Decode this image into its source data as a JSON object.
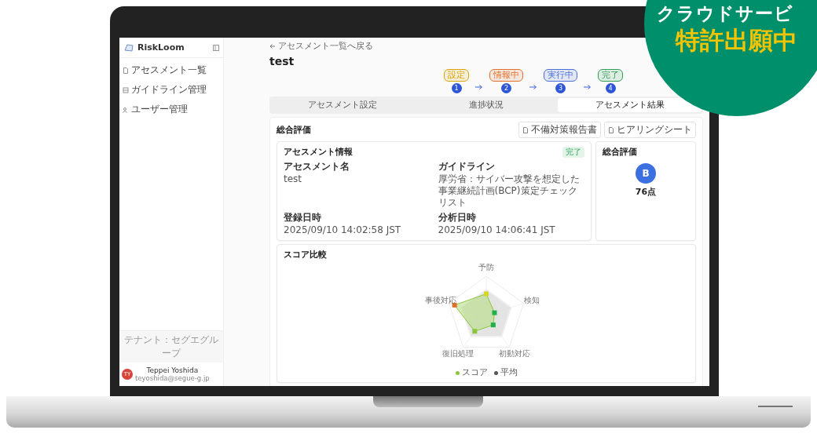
{
  "banner": {
    "line_1": "クラウドサービ",
    "line_2": "特許出願中"
  },
  "sidebar": {
    "brand": "RiskLoom",
    "items": [
      {
        "label": "アセスメント一覧",
        "selected": false
      },
      {
        "label": "ガイドライン管理",
        "selected": false
      },
      {
        "label": "ユーザー管理",
        "selected": false
      }
    ],
    "tenant": "テナント：セグエグループ",
    "user": {
      "initials": "TY",
      "name": "Teppei Yoshida",
      "email": "teyoshida@segue-g.jp"
    }
  },
  "main": {
    "back_link": "アセスメント一覧へ戻る",
    "title": "test",
    "steps": [
      {
        "label": "設定",
        "number": "1",
        "color": "#d9a400"
      },
      {
        "label": "情報中",
        "number": "2",
        "color": "#e0702a"
      },
      {
        "label": "実行中",
        "number": "3",
        "color": "#4a6fd8"
      },
      {
        "label": "完了",
        "number": "4",
        "color": "#2f9e57"
      }
    ],
    "tabs": [
      {
        "label": "アセスメント設定",
        "selected": false
      },
      {
        "label": "進捗状況",
        "selected": false
      },
      {
        "label": "アセスメント結果",
        "selected": true
      }
    ],
    "section_title": "総合評価",
    "buttons": [
      "不備対策報告書",
      "ヒアリングシート"
    ],
    "info_card": {
      "title": "アセスメント情報",
      "status": "完了",
      "fields": [
        {
          "label": "アセスメント名",
          "value": "test"
        },
        {
          "label": "ガイドライン",
          "value": "厚労省：サイバー攻撃を想定した事業継続計画(BCP)策定チェックリスト"
        },
        {
          "label": "登録日時",
          "value": "2025/09/10 14:02:58 JST"
        },
        {
          "label": "分析日時",
          "value": "2025/09/10 14:06:41 JST"
        }
      ]
    },
    "score_card": {
      "title": "総合評価",
      "grade": "B",
      "score": "76点"
    },
    "radar_card": {
      "title": "スコア比較",
      "axes": [
        "予防",
        "検知",
        "初動対応",
        "復旧処理",
        "事後対応"
      ],
      "legend": [
        {
          "label": "スコア",
          "color": "#8cc63f"
        },
        {
          "label": "平均",
          "color": "#555555"
        }
      ]
    }
  }
}
